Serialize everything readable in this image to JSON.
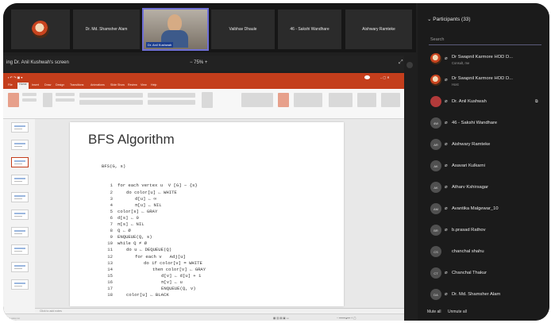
{
  "tiles": [
    {
      "name": "",
      "type": "photo"
    },
    {
      "name": "Dr. Md. Shamsher Alam"
    },
    {
      "name": "Dr. Anil Kushwah",
      "type": "video"
    },
    {
      "name": "Vaibhav Dhaule"
    },
    {
      "name": "46 - Sakshi Wandhare"
    },
    {
      "name": "Aishwary Ramteke"
    }
  ],
  "share": {
    "who": "ing Dr. Anil Kushwah's screen",
    "zoom": "−  75%  +"
  },
  "ppt": {
    "tabs": [
      "File",
      "Home",
      "Insert",
      "Draw",
      "Design",
      "Transitions",
      "Animations",
      "Slide Show",
      "Review",
      "View",
      "Help"
    ],
    "notes_placeholder": "Click to add notes",
    "slide_title": "BFS Algorithm",
    "code_header": "BFS(G, s)",
    "code_lines": [
      {
        "n": "1",
        "indent": 0,
        "text": "for each vertex u  V [G] − {s}",
        "kw": "for"
      },
      {
        "n": "2",
        "indent": 1,
        "text": "do color[u] ← WHITE",
        "kw": "do"
      },
      {
        "n": "3",
        "indent": 2,
        "text": "d[u] ← ∞",
        "kw": ""
      },
      {
        "n": "4",
        "indent": 2,
        "text": "π[u] ← NIL",
        "kw": ""
      },
      {
        "n": "5",
        "indent": 0,
        "text": "color[s] ← GRAY",
        "kw": ""
      },
      {
        "n": "6",
        "indent": 0,
        "text": "d[s] ← 0",
        "kw": ""
      },
      {
        "n": "7",
        "indent": 0,
        "text": "π[s] ← NIL",
        "kw": ""
      },
      {
        "n": "8",
        "indent": 0,
        "text": "Q ← Ø",
        "kw": ""
      },
      {
        "n": "9",
        "indent": 0,
        "text": "ENQUEUE(Q, s)",
        "kw": ""
      },
      {
        "n": "10",
        "indent": 0,
        "text": "while Q ≠ Ø",
        "kw": "while"
      },
      {
        "n": "11",
        "indent": 1,
        "text": "do u ← DEQUEUE(Q)",
        "kw": "do"
      },
      {
        "n": "12",
        "indent": 2,
        "text": "for each v   Adj[u]",
        "kw": "for"
      },
      {
        "n": "13",
        "indent": 3,
        "text": "do if color[v] = WHITE",
        "kw": "do if"
      },
      {
        "n": "14",
        "indent": 4,
        "text": "then color[v] ← GRAY",
        "kw": "then"
      },
      {
        "n": "15",
        "indent": 5,
        "text": "d[v] ← d[u] + 1",
        "kw": ""
      },
      {
        "n": "16",
        "indent": 5,
        "text": "π[v] ← u",
        "kw": ""
      },
      {
        "n": "17",
        "indent": 5,
        "text": "ENQUEUE(Q, v)",
        "kw": ""
      },
      {
        "n": "18",
        "indent": 1,
        "text": "color[u] ← BLACK",
        "kw": ""
      }
    ]
  },
  "panel": {
    "title": "Participants (33)",
    "search_placeholder": "Search",
    "participants": [
      {
        "avatar": "",
        "avatar_type": "photo",
        "name": "Dr Swapnil Karmore HOD D...",
        "sub": "Consult, me"
      },
      {
        "avatar": "",
        "avatar_type": "photo",
        "name": "Dr Swapnil Karmore HOD D...",
        "sub": "Host"
      },
      {
        "avatar": "",
        "avatar_type": "red",
        "name": "Dr. Anil Kushwah",
        "sub": "",
        "presenting": true
      },
      {
        "avatar": "4W",
        "name": "46 - Sakshi Wandhare"
      },
      {
        "avatar": "AR",
        "name": "Aishwary Ramteke"
      },
      {
        "avatar": "AK",
        "name": "Asavari Kulkarni"
      },
      {
        "avatar": "AK",
        "name": "Atharv Kshirsagar"
      },
      {
        "avatar": "AM",
        "name": "Avantika Malgewar_10"
      },
      {
        "avatar": "BR",
        "name": "b.prasad Rathov"
      },
      {
        "avatar": "CS",
        "name": "chanchal shahu",
        "no_mic": true
      },
      {
        "avatar": "CT",
        "name": "Chanchal Thakur"
      },
      {
        "avatar": "DA",
        "name": "Dr. Md. Shamsher Alam"
      }
    ],
    "mute_all": "Mute all",
    "unmute_all": "Unmute all"
  }
}
